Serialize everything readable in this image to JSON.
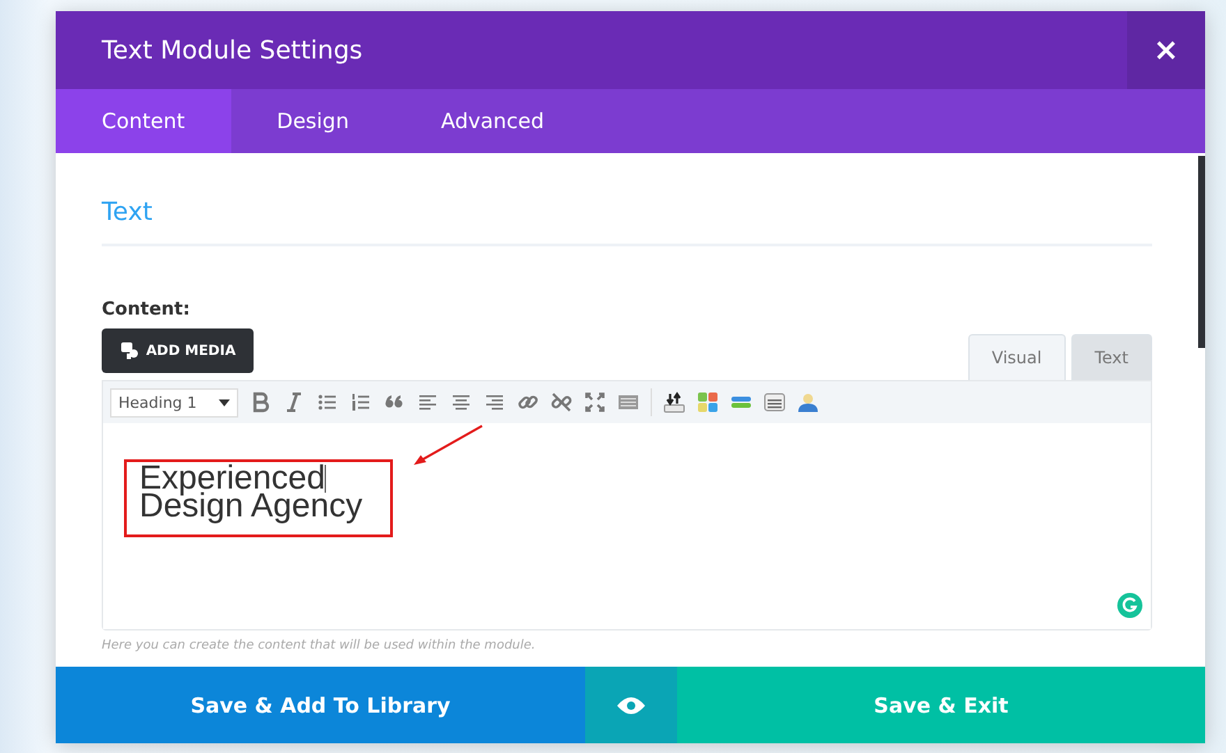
{
  "window": {
    "title": "Text Module Settings",
    "close": "×"
  },
  "tabs": [
    {
      "label": "Content",
      "selected": true
    },
    {
      "label": "Design",
      "selected": false
    },
    {
      "label": "Advanced",
      "selected": false
    }
  ],
  "section": {
    "title": "Text"
  },
  "content": {
    "label": "Content:",
    "add_media": "ADD MEDIA",
    "editor_tabs": [
      {
        "label": "Visual",
        "selected": true
      },
      {
        "label": "Text",
        "selected": false
      }
    ],
    "format": "Heading 1",
    "lines": [
      "Experienced",
      "Design Agency"
    ],
    "hint": "Here you can create the content that will be used within the module."
  },
  "footer": {
    "save_library": "Save & Add To Library",
    "save_exit": "Save & Exit"
  }
}
